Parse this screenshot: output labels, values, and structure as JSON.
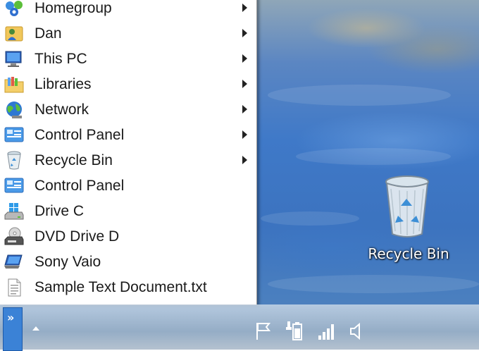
{
  "menu": {
    "items": [
      {
        "label": "Homegroup",
        "icon": "homegroup-icon",
        "submenu": true
      },
      {
        "label": "Dan",
        "icon": "user-folder-icon",
        "submenu": true
      },
      {
        "label": "This PC",
        "icon": "computer-icon",
        "submenu": true
      },
      {
        "label": "Libraries",
        "icon": "libraries-folder-icon",
        "submenu": true
      },
      {
        "label": "Network",
        "icon": "network-globe-icon",
        "submenu": true
      },
      {
        "label": "Control Panel",
        "icon": "control-panel-icon",
        "submenu": true
      },
      {
        "label": "Recycle Bin",
        "icon": "recycle-bin-icon",
        "submenu": true
      },
      {
        "label": "Control Panel",
        "icon": "control-panel-icon",
        "submenu": false
      },
      {
        "label": "Drive C",
        "icon": "windows-drive-icon",
        "submenu": false
      },
      {
        "label": "DVD Drive D",
        "icon": "dvd-drive-icon",
        "submenu": false
      },
      {
        "label": "Sony Vaio",
        "icon": "laptop-icon",
        "submenu": false
      },
      {
        "label": "Sample Text Document.txt",
        "icon": "text-document-icon",
        "submenu": false
      }
    ]
  },
  "desktop": {
    "recycle_bin_label": "Recycle Bin"
  },
  "taskbar": {
    "expand_glyph": "»",
    "tray_icons": [
      "flag-icon",
      "battery-icon",
      "signal-bars-icon",
      "speaker-icon"
    ]
  },
  "colors": {
    "accent_blue": "#3b82d6",
    "menu_background": "#ffffff",
    "menu_text": "#1a1a1a"
  }
}
